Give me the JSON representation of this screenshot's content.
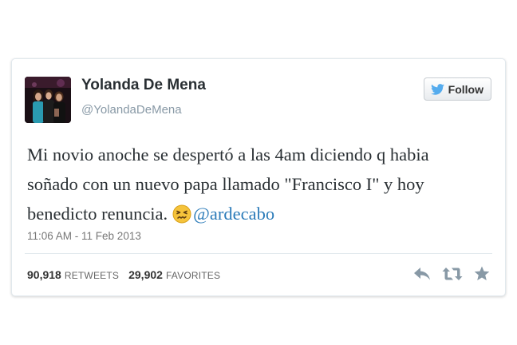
{
  "user": {
    "display_name": "Yolanda De Mena",
    "handle": "@YolandaDeMena",
    "avatar_icon": "profile-photo"
  },
  "follow_button": {
    "label": "Follow",
    "icon": "twitter-bird-icon",
    "icon_color": "#55acee"
  },
  "tweet": {
    "line1": "Mi novio anoche se despertó a las 4am diciendo q habia",
    "line2": "soñado con un nuevo papa llamado \"Francisco I\" y hoy",
    "line3_text": "benedicto renuncia.",
    "emoji": "confounded-face-emoji",
    "mention": "@ardecabo",
    "mention_color": "#2b7bb9"
  },
  "timestamp": "11:06 AM - 11 Feb 2013",
  "stats": {
    "retweets_count": "90,918",
    "retweets_label": "RETWEETS",
    "favorites_count": "29,902",
    "favorites_label": "FAVORITES"
  },
  "actions": {
    "reply_icon": "reply-icon",
    "retweet_icon": "retweet-icon",
    "favorite_icon": "star-icon"
  }
}
